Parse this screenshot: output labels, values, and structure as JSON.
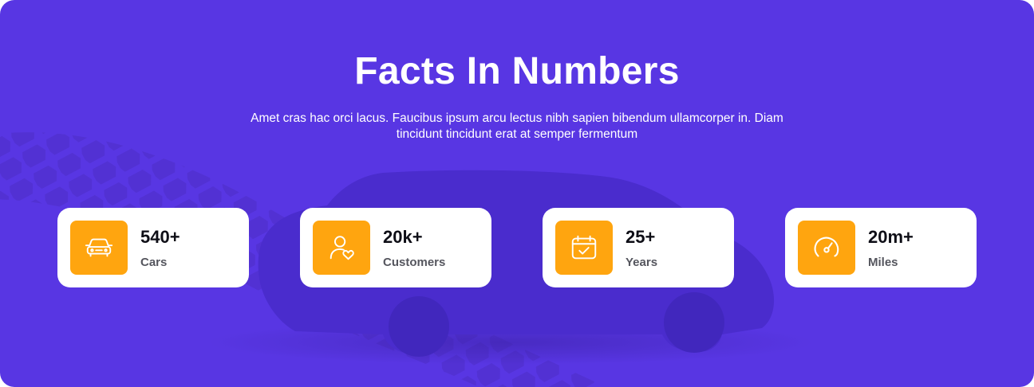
{
  "section": {
    "title": "Facts In Numbers",
    "subtitle": "Amet cras hac orci lacus. Faucibus ipsum arcu lectus nibh sapien bibendum ullamcorper in. Diam tincidunt tincidunt erat at semper fermentum"
  },
  "stats": [
    {
      "value": "540+",
      "label": "Cars",
      "icon": "car-icon"
    },
    {
      "value": "20k+",
      "label": "Customers",
      "icon": "user-heart-icon"
    },
    {
      "value": "25+",
      "label": "Years",
      "icon": "calendar-check-icon"
    },
    {
      "value": "20m+",
      "label": "Miles",
      "icon": "speedometer-icon"
    }
  ],
  "colors": {
    "background": "#5836e3",
    "accent": "#ffa50f",
    "card": "#ffffff",
    "text_dark": "#0e0e16",
    "text_muted": "#55565e"
  }
}
